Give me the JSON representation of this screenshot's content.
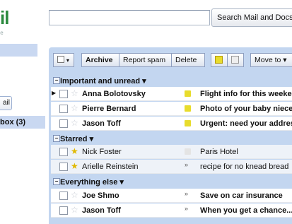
{
  "logo": {
    "mark": "il",
    "sub": "gle"
  },
  "search": {
    "button_label": "Search Mail and Docs"
  },
  "sidebar": {
    "mail_button": "ail",
    "inbox_label": "box (3)"
  },
  "toolbar": {
    "archive": "Archive",
    "report_spam": "Report spam",
    "delete": "Delete",
    "move_to": "Move to ▾"
  },
  "sections": [
    {
      "label": "Important and unread ▾"
    },
    {
      "label": "Starred ▾"
    },
    {
      "label": "Everything else ▾"
    }
  ],
  "emails": [
    {
      "from": "Anna Bolotovsky",
      "subject": "Flight info for this weekend",
      "unread": true,
      "starred": false,
      "important": "yes"
    },
    {
      "from": "Pierre Bernard",
      "subject": "Photo of your baby niece",
      "unread": true,
      "starred": false,
      "important": "yes"
    },
    {
      "from": "Jason Toff",
      "subject": "Urgent: need your address",
      "unread": true,
      "starred": false,
      "important": "yes"
    },
    {
      "from": "Nick Foster",
      "subject": "Paris Hotel",
      "unread": false,
      "starred": true,
      "important": "no"
    },
    {
      "from": "Arielle Reinstein",
      "subject": "recipe for no knead bread",
      "unread": false,
      "starred": true,
      "important": "chevron"
    },
    {
      "from": "Joe Shmo",
      "subject": "Save on car insurance",
      "unread": true,
      "starred": false,
      "important": "chevron"
    },
    {
      "from": "Jason Toff",
      "subject": "When you get a chance...",
      "unread": true,
      "starred": false,
      "important": "chevron"
    }
  ]
}
